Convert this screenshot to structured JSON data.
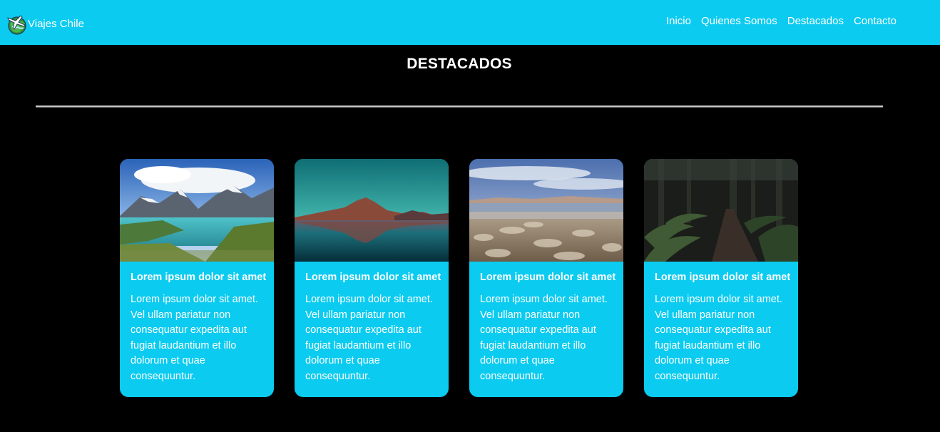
{
  "brand": {
    "name": "Viajes Chile",
    "logo_icon": "globe-plane-icon"
  },
  "nav": {
    "items": [
      {
        "label": "Inicio"
      },
      {
        "label": "Quienes Somos"
      },
      {
        "label": "Destacados"
      },
      {
        "label": "Contacto"
      }
    ]
  },
  "section": {
    "title": "DESTACADOS"
  },
  "cards": [
    {
      "image": "mountain-lake-photo",
      "title": "Lorem ipsum dolor sit amet",
      "text": "Lorem ipsum dolor sit amet. Vel ullam pariatur non consequatur expedita aut fugiat laudantium et illo dolorum et quae consequuntur."
    },
    {
      "image": "volcano-reflection-photo",
      "title": "Lorem ipsum dolor sit amet",
      "text": "Lorem ipsum dolor sit amet. Vel ullam pariatur non consequatur expedita aut fugiat laudantium et illo dolorum et quae consequuntur."
    },
    {
      "image": "salt-flat-photo",
      "title": "Lorem ipsum dolor sit amet",
      "text": "Lorem ipsum dolor sit amet. Vel ullam pariatur non consequatur expedita aut fugiat laudantium et illo dolorum et quae consequuntur."
    },
    {
      "image": "forest-path-photo",
      "title": "Lorem ipsum dolor sit amet",
      "text": "Lorem ipsum dolor sit amet. Vel ullam pariatur non consequatur expedita aut fugiat laudantium et illo dolorum et quae consequuntur."
    }
  ],
  "colors": {
    "accent": "#0bcbf0",
    "background": "#000000",
    "text": "#ffffff"
  }
}
